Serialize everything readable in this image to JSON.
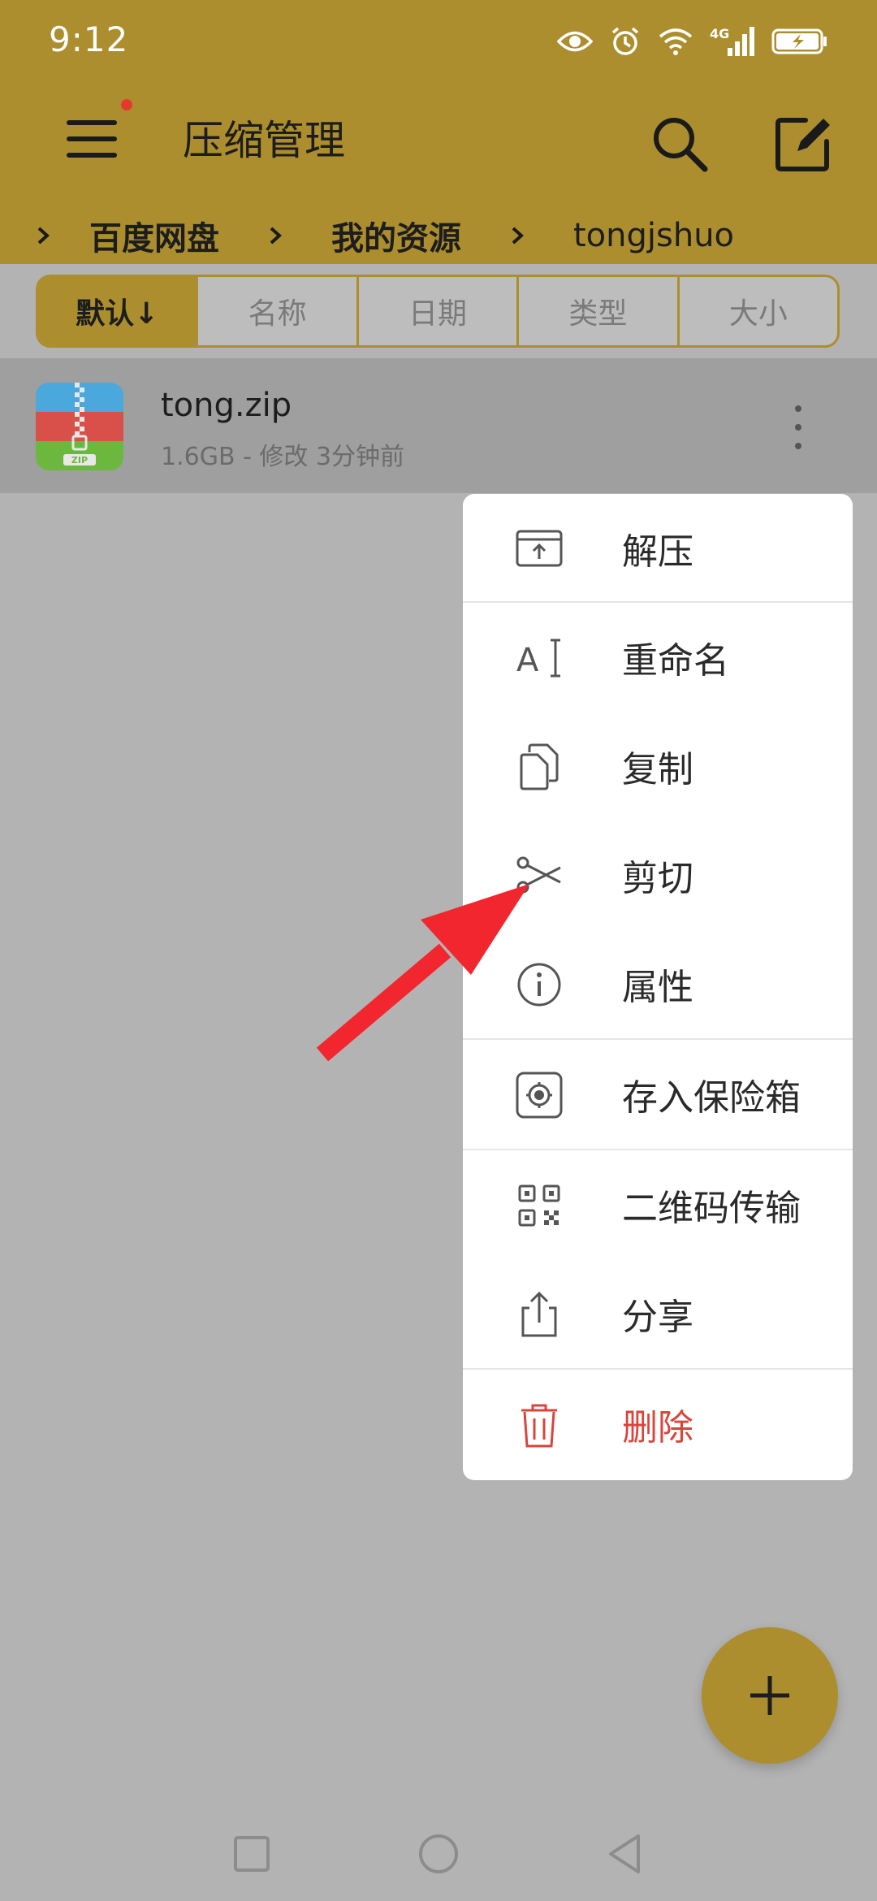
{
  "status": {
    "time": "9:12",
    "network": "4G"
  },
  "header": {
    "title": "压缩管理"
  },
  "breadcrumb": [
    "百度网盘",
    "我的资源",
    "tongjshuo"
  ],
  "sort_tabs": [
    {
      "label": "默认↓",
      "active": true
    },
    {
      "label": "名称",
      "active": false
    },
    {
      "label": "日期",
      "active": false
    },
    {
      "label": "类型",
      "active": false
    },
    {
      "label": "大小",
      "active": false
    }
  ],
  "file": {
    "name": "tong.zip",
    "meta": "1.6GB - 修改 3分钟前",
    "icon_label": "ZIP"
  },
  "context_menu": [
    {
      "label": "解压",
      "icon": "extract-icon"
    },
    {
      "label": "重命名",
      "icon": "rename-icon"
    },
    {
      "label": "复制",
      "icon": "copy-icon"
    },
    {
      "label": "剪切",
      "icon": "scissors-icon"
    },
    {
      "label": "属性",
      "icon": "info-icon"
    },
    {
      "label": "存入保险箱",
      "icon": "safe-icon"
    },
    {
      "label": "二维码传输",
      "icon": "qr-code-icon"
    },
    {
      "label": "分享",
      "icon": "share-icon"
    },
    {
      "label": "删除",
      "icon": "trash-icon",
      "danger": true
    }
  ],
  "colors": {
    "accent": "#ac8e2e",
    "overlay": "#b3b3b3",
    "danger": "#d9443b",
    "arrow": "#f2262e"
  }
}
